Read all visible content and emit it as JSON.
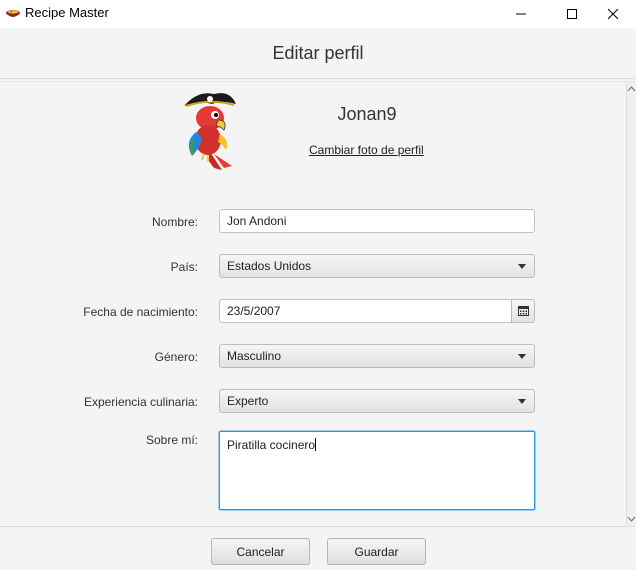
{
  "window": {
    "title": "Recipe Master",
    "icon": "recipe-bowl-icon"
  },
  "header": {
    "title": "Editar perfil"
  },
  "profile": {
    "username": "Jonan9",
    "change_photo_label": "Cambiar foto de perfil",
    "avatar": "pirate-parrot-avatar"
  },
  "form": {
    "nombre": {
      "label": "Nombre:",
      "value": "Jon Andoni"
    },
    "pais": {
      "label": "País:",
      "value": "Estados Unidos"
    },
    "fecha": {
      "label": "Fecha de nacimiento:",
      "value": "23/5/2007"
    },
    "genero": {
      "label": "Género:",
      "value": "Masculino"
    },
    "experiencia": {
      "label": "Experiencia culinaria:",
      "value": "Experto"
    },
    "sobre": {
      "label": "Sobre mí:",
      "value": "Piratilla cocinero"
    }
  },
  "buttons": {
    "cancel": "Cancelar",
    "save": "Guardar"
  },
  "colors": {
    "focus_border": "#2a97e0",
    "background": "#f4f4f4"
  }
}
